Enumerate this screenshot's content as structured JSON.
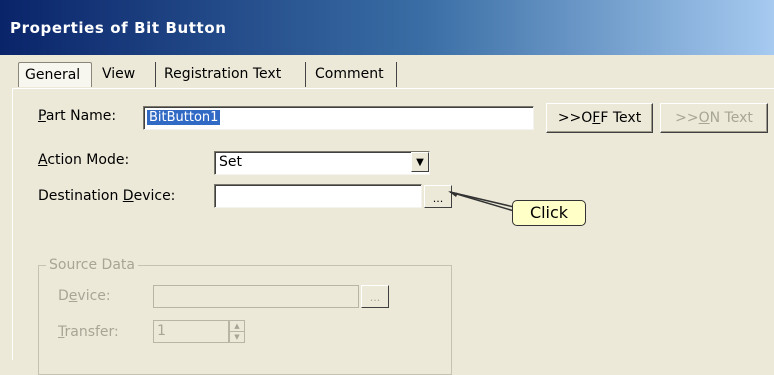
{
  "window": {
    "title": "Properties of Bit Button"
  },
  "tabs": [
    {
      "label": "General"
    },
    {
      "label": "View"
    },
    {
      "label": "Registration Text"
    },
    {
      "label": "Comment"
    }
  ],
  "general": {
    "part_name_label_prefix": "P",
    "part_name_label_rest": "art Name:",
    "part_name_value": "BitButton1",
    "off_text_button": {
      "prefix": ">>O",
      "underlined": "F",
      "rest": "F Text"
    },
    "on_text_button": {
      "prefix": ">>",
      "underlined": "O",
      "rest": "N Text"
    },
    "action_mode_label_prefix": "A",
    "action_mode_label_rest": "ction Mode:",
    "action_mode_value": "Set",
    "destination_label_prefix": "Destination ",
    "destination_label_underlined": "D",
    "destination_label_rest": "evice:",
    "destination_value": "",
    "browse_button": "...",
    "callout": "Click"
  },
  "source_data": {
    "title": "Source Data",
    "device_label_prefix": "D",
    "device_label_underlined": "e",
    "device_label_rest": "vice:",
    "device_value": "",
    "browse_button": "...",
    "transfer_label_prefix": "",
    "transfer_label_underlined": "T",
    "transfer_label_rest": "ransfer:",
    "transfer_value": "1"
  },
  "colors": {
    "title_bar_start": "#0a246a",
    "title_bar_end": "#a6caf0",
    "dialog_background": "#ece9d8",
    "selection": "#316ac5",
    "callout_background": "#ffffc8"
  }
}
